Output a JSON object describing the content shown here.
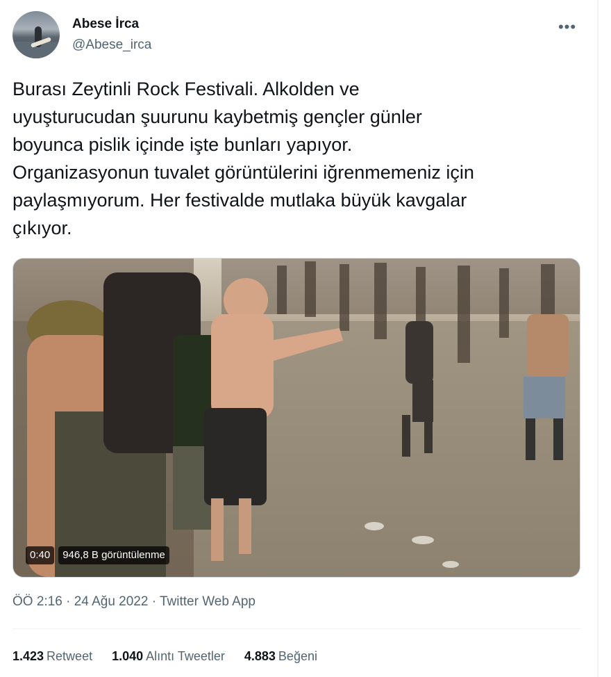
{
  "author": {
    "name": "Abese İrca",
    "handle": "@Abese_irca"
  },
  "tweet": {
    "text": "Burası Zeytinli Rock Festivali. Alkolden ve\nuyuşturucudan şuurunu kaybetmiş gençler günler\nboyunca pislik içinde işte bunları yapıyor.\nOrganizasyonun tuvalet görüntülerini iğrenmemeniz için\npaylaşmıyorum. Her festivalde mutlaka büyük kavgalar\nçıkıyor."
  },
  "video": {
    "duration": "0:40",
    "views": "946,8 B görüntülenme"
  },
  "meta": {
    "time": "ÖÖ 2:16",
    "separator1": " · ",
    "date": "24 Ağu 2022",
    "separator2": " · ",
    "source": "Twitter Web App"
  },
  "stats": {
    "retweets": {
      "count": "1.423",
      "label": "Retweet"
    },
    "quotes": {
      "count": "1.040",
      "label": "Alıntı Tweetler"
    },
    "likes": {
      "count": "4.883",
      "label": "Beğeni"
    }
  },
  "icons": {
    "more": "more-options-icon"
  }
}
